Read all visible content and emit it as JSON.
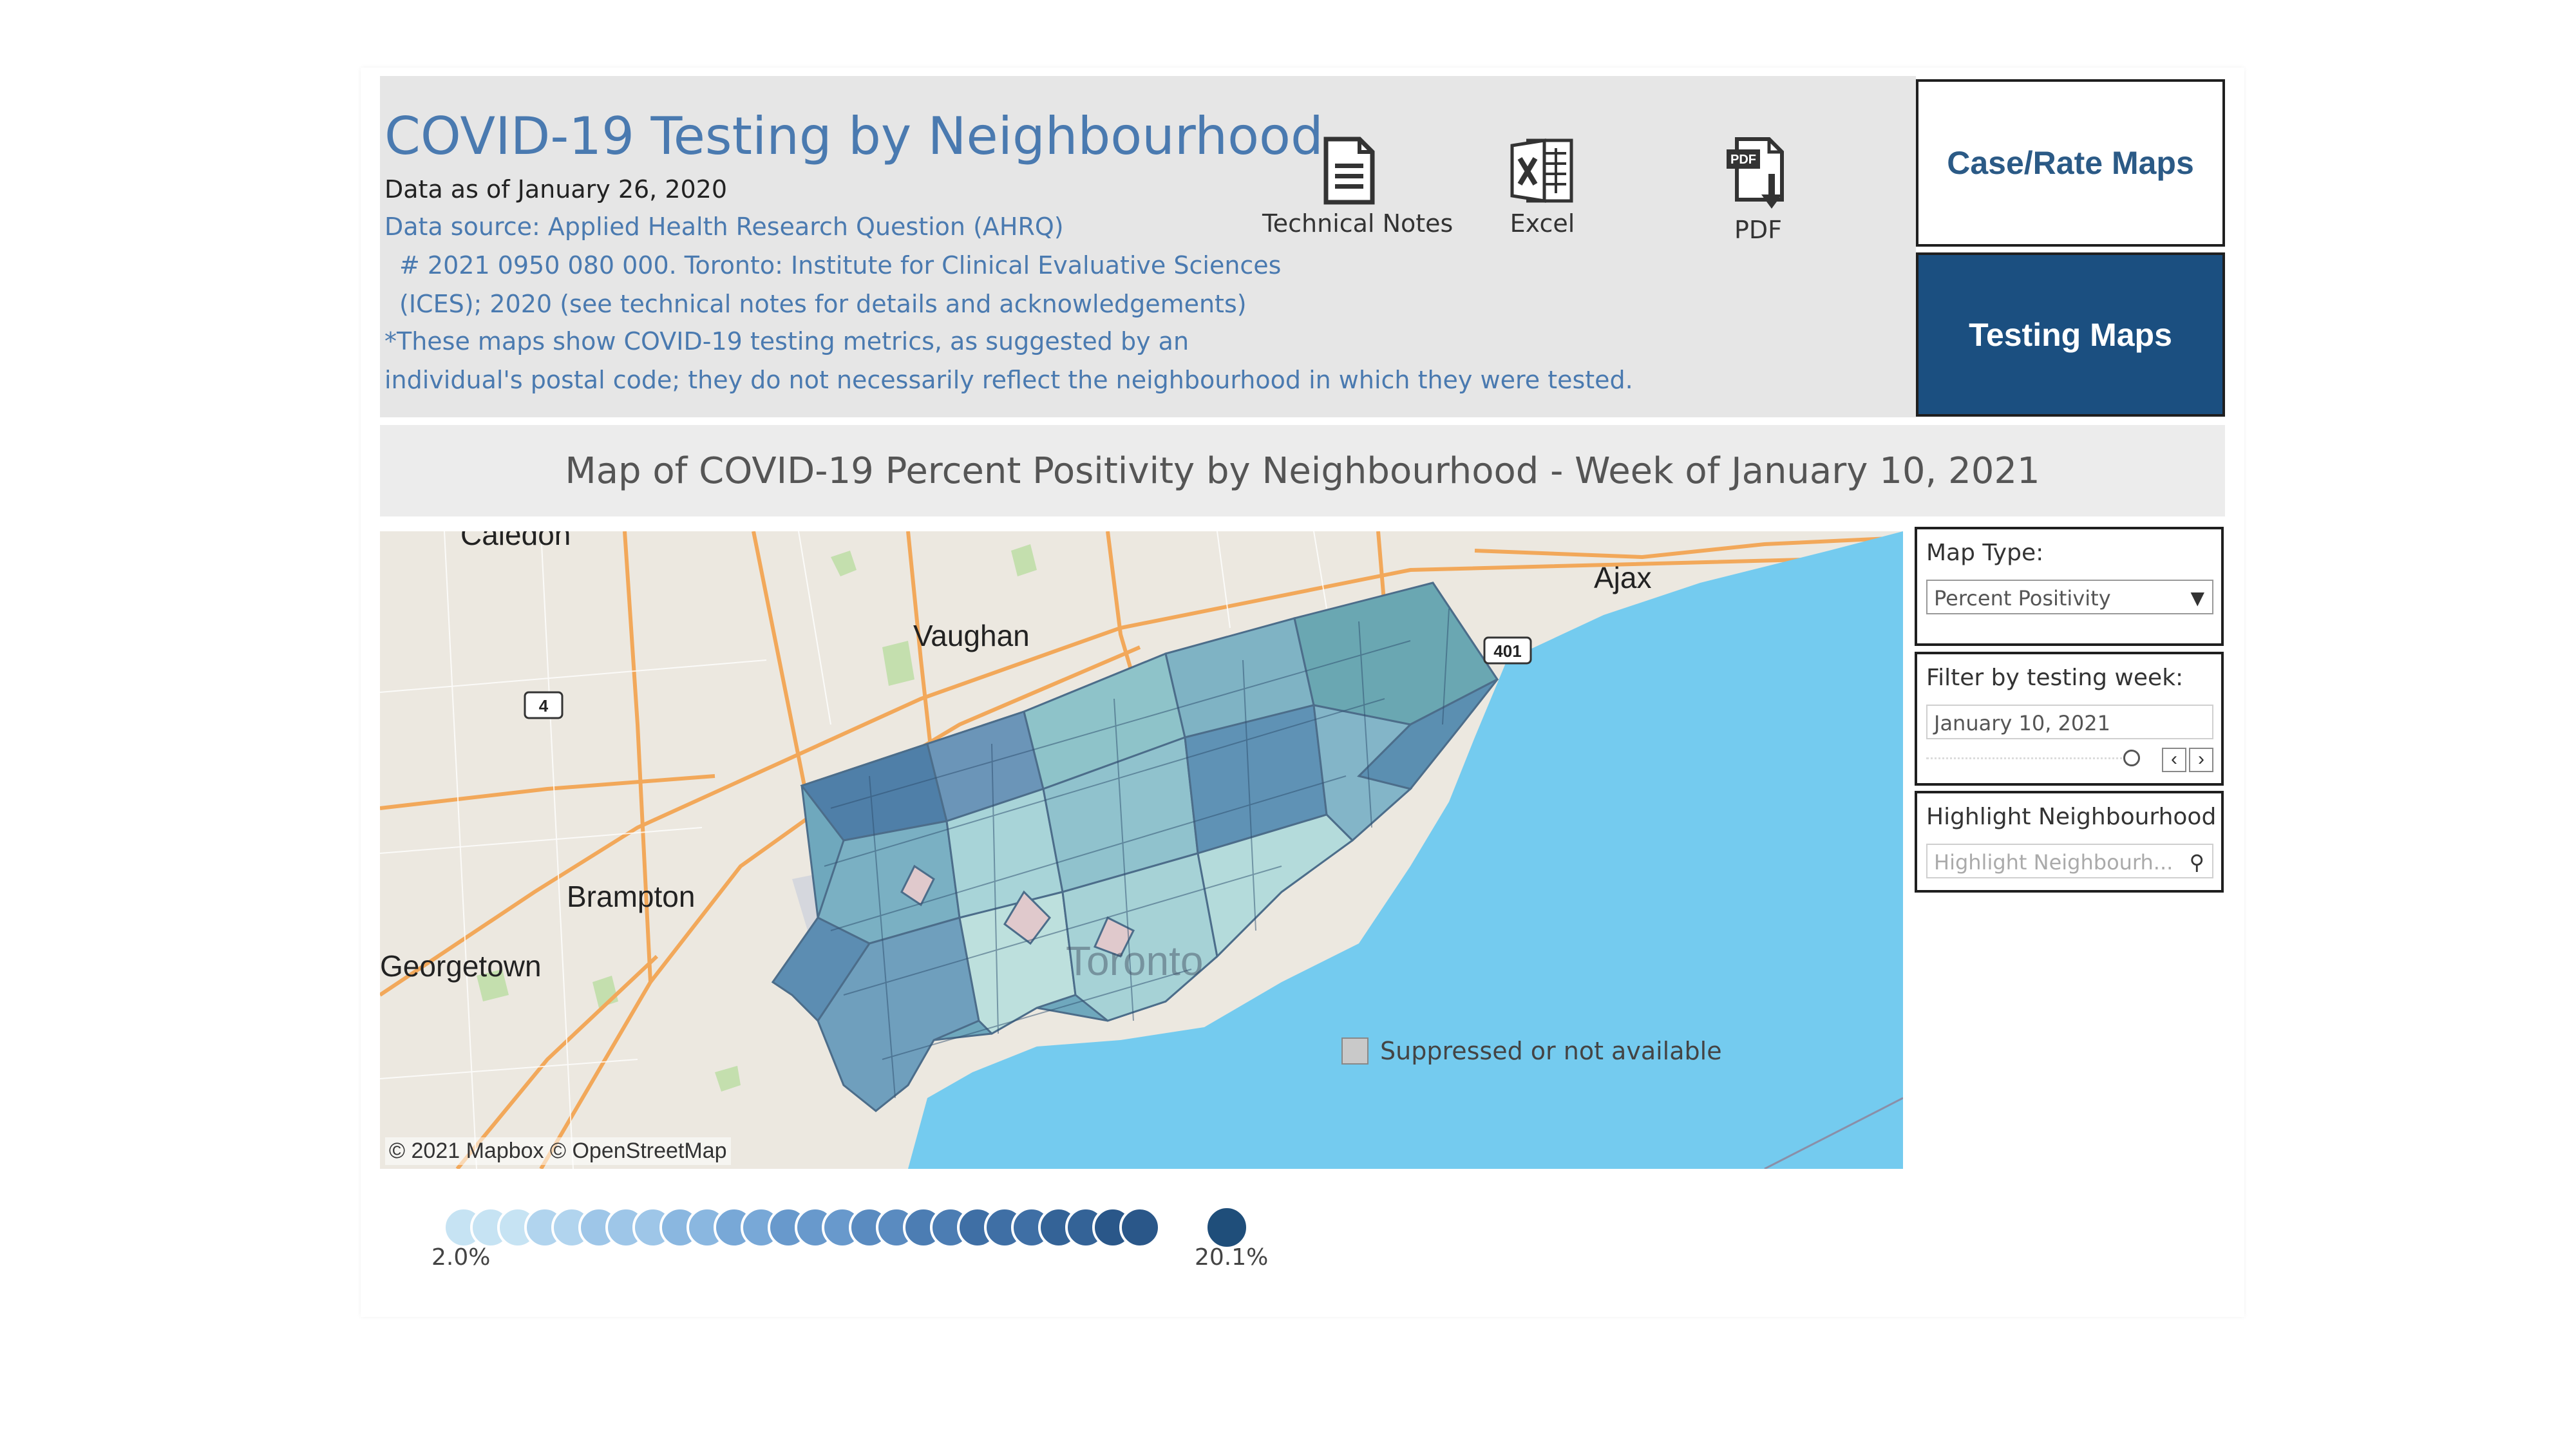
{
  "header": {
    "title": "COVID-19 Testing by Neighbourhood",
    "data_as_of": "Data as of January 26, 2020",
    "source_line1": "Data source: Applied Health Research Question (AHRQ)",
    "source_line2": "# 2021 0950 080 000. Toronto: Institute for Clinical Evaluative Sciences",
    "source_line3": "(ICES); 2020 (see technical notes for details and acknowledgements)",
    "note_line1": "*These maps show COVID-19 testing metrics, as suggested by an",
    "note_line2": "individual's postal code; they do not necessarily reflect the neighbourhood in which they were tested."
  },
  "downloads": [
    {
      "label": "Technical Notes",
      "icon": "document-icon"
    },
    {
      "label": "Excel",
      "icon": "excel-icon"
    },
    {
      "label": "PDF",
      "icon": "pdf-download-icon"
    }
  ],
  "nav": {
    "case_rate_label": "Case/Rate Maps",
    "testing_label": "Testing Maps",
    "active": "Testing Maps"
  },
  "subtitle": "Map of COVID-19 Percent Positivity by Neighbourhood - Week of January 10, 2021",
  "map": {
    "places": [
      "Caledon",
      "Vaughan",
      "Ajax",
      "Brampton",
      "Georgetown",
      "Toronto"
    ],
    "highway_shields": [
      "4",
      "401"
    ],
    "credit": "© 2021 Mapbox  © OpenStreetMap",
    "suppressed_label": "Suppressed or not available",
    "colors": {
      "water": "#74cbef",
      "land": "#ece8e0",
      "roads": "#f2a85a",
      "choropleth_low": "#b9dfe0",
      "choropleth_high": "#3d6d96"
    }
  },
  "filters": {
    "map_type_title": "Map Type:",
    "map_type_value": "Percent Positivity",
    "week_title": "Filter by testing week:",
    "week_value": "January 10, 2021",
    "highlight_title": "Highlight Neighbourhood",
    "highlight_placeholder": "Highlight Neighbourh..."
  },
  "legend": {
    "min_label": "2.0%",
    "max_label": "20.1%",
    "colors": [
      "#c6e3f3",
      "#b1d4ee",
      "#9ec6e8",
      "#8ab7e0",
      "#78a8d7",
      "#6899cc",
      "#5a8bc0",
      "#4c7db3",
      "#3f6fa5",
      "#346397",
      "#2a5789"
    ]
  }
}
